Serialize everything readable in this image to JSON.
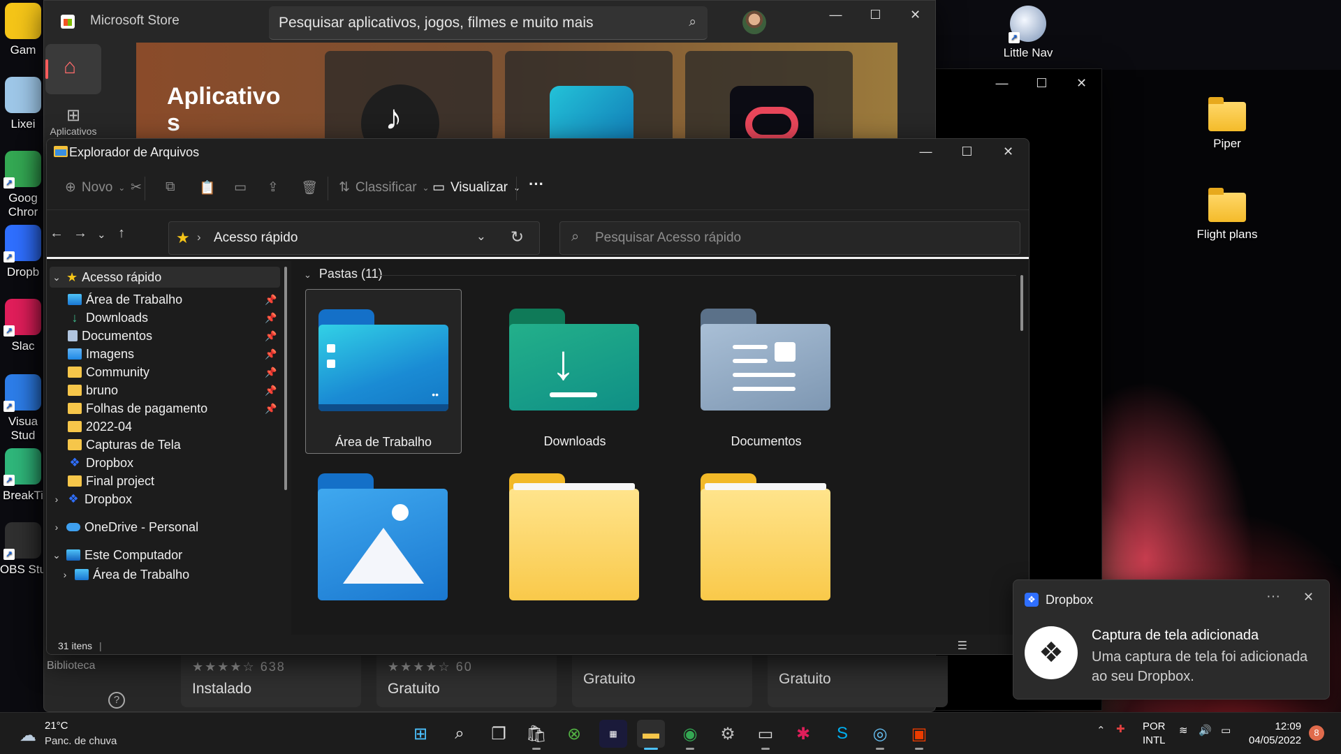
{
  "desktop": {
    "left_icons": [
      {
        "label": "Gam",
        "color": "#f5c518"
      },
      {
        "label": "Lixei",
        "color": "#9ec7e8"
      },
      {
        "label": "Goog\nChror",
        "color": "#34a853"
      },
      {
        "label": "Dropb",
        "color": "#2f6fff"
      },
      {
        "label": "Slac",
        "color": "#e01e5a"
      },
      {
        "label": "Visua\nStud",
        "color": "#2d7de8"
      },
      {
        "label": "BreakTi",
        "color": "#2fb67a"
      },
      {
        "label": "OBS Stu",
        "color": "#303030"
      }
    ],
    "right_icons": [
      {
        "label": "Little Nav"
      },
      {
        "label": "Piper"
      },
      {
        "label": "Flight plans"
      }
    ]
  },
  "store": {
    "title": "Microsoft Store",
    "search_placeholder": "Pesquisar aplicativos, jogos, filmes e muito mais",
    "nav_apps_label": "Aplicativos",
    "banner_title": "Aplicativo\ns",
    "library_label": "Biblioteca",
    "cards": [
      {
        "rating": "★★★★☆",
        "count": "638",
        "price": "Instalado"
      },
      {
        "rating": "★★★★☆",
        "count": "60",
        "price": "Gratuito"
      },
      {
        "rating": "",
        "count": "",
        "price": "Gratuito"
      },
      {
        "rating": "",
        "count": "",
        "price": "Gratuito"
      }
    ]
  },
  "explorer": {
    "title": "Explorador de Arquivos",
    "commands": {
      "new": "Novo",
      "sort": "Classificar",
      "view": "Visualizar",
      "more": "···"
    },
    "address": "Acesso rápido",
    "search_placeholder": "Pesquisar Acesso rápido",
    "nav": {
      "quick_access": "Acesso rápido",
      "pinned": [
        {
          "label": "Área de Trabalho",
          "icon": "desktop-icon",
          "pinned": true
        },
        {
          "label": "Downloads",
          "icon": "download-icon",
          "pinned": true
        },
        {
          "label": "Documentos",
          "icon": "document-icon",
          "pinned": true
        },
        {
          "label": "Imagens",
          "icon": "image-icon",
          "pinned": true
        },
        {
          "label": "Community",
          "icon": "folder-icon",
          "pinned": true
        },
        {
          "label": "bruno",
          "icon": "folder-icon",
          "pinned": true
        },
        {
          "label": "Folhas de pagamento",
          "icon": "folder-icon",
          "pinned": true
        },
        {
          "label": "2022-04",
          "icon": "folder-icon",
          "pinned": false
        },
        {
          "label": "Capturas de Tela",
          "icon": "folder-icon",
          "pinned": false
        },
        {
          "label": "Dropbox",
          "icon": "dropbox-icon",
          "pinned": false
        },
        {
          "label": "Final project",
          "icon": "folder-icon",
          "pinned": false
        }
      ],
      "dropbox": "Dropbox",
      "onedrive": "OneDrive - Personal",
      "this_pc": "Este Computador",
      "this_pc_child": "Área de Trabalho"
    },
    "group_header": "Pastas (11)",
    "folders": [
      {
        "label": "Área de Trabalho",
        "kind": "desktop"
      },
      {
        "label": "Downloads",
        "kind": "downloads"
      },
      {
        "label": "Documentos",
        "kind": "documents"
      },
      {
        "label": "",
        "kind": "pictures"
      },
      {
        "label": "",
        "kind": "folder"
      },
      {
        "label": "",
        "kind": "folder"
      }
    ],
    "status": "31 itens"
  },
  "toast": {
    "app": "Dropbox",
    "heading": "Captura de tela adicionada",
    "body": "Uma captura de tela foi adicionada ao seu Dropbox."
  },
  "taskbar": {
    "temperature": "21°C",
    "weather": "Panc. de chuva",
    "lang1": "POR",
    "lang2": "INTL",
    "time": "12:09",
    "date": "04/05/2022",
    "notifications": "8"
  }
}
